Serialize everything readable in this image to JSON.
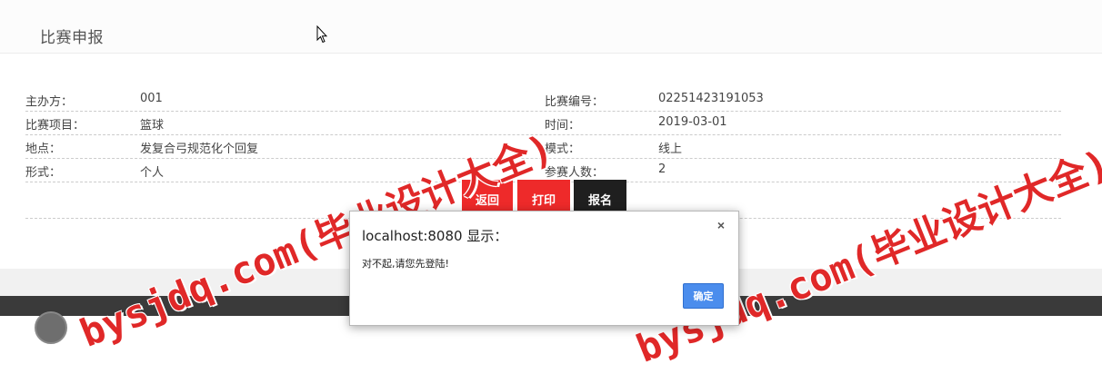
{
  "page": {
    "title": "比赛申报"
  },
  "info_rows": [
    {
      "left_label": "主办方：",
      "left_value": "001",
      "right_label": "比赛编号：",
      "right_value": "02251423191053"
    },
    {
      "left_label": "比赛项目：",
      "left_value": "篮球",
      "right_label": "时间：",
      "right_value": "2019-03-01"
    },
    {
      "left_label": "地点：",
      "left_value": "发复合弓规范化个回复",
      "right_label": "模式：",
      "right_value": "线上"
    },
    {
      "left_label": "形式：",
      "left_value": "个人",
      "right_label": "参赛人数：",
      "right_value": "2"
    }
  ],
  "buttons": {
    "back": "返回",
    "print": "打印",
    "signup": "报名"
  },
  "dialog": {
    "title": "localhost:8080 显示：",
    "message": "对不起,请您先登陆!",
    "close": "×",
    "ok": "确定"
  },
  "watermark": {
    "text": "bysjdq.com(毕业设计大全)"
  },
  "colors": {
    "accent_red": "#ee2a2a",
    "dark_button": "#1f1f1f",
    "dialog_ok": "#4b8ded",
    "watermark": "#e02828"
  },
  "icons": {
    "cursor": "mouse-pointer-icon",
    "close": "close-icon",
    "footer_logo": "logo-icon"
  }
}
